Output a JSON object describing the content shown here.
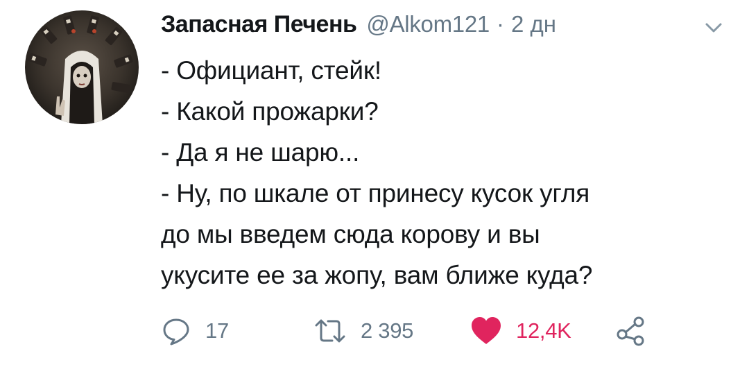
{
  "tweet": {
    "author": {
      "display_name": "Запасная Печень",
      "handle": "@Alkom121",
      "avatar_icon": "user-avatar"
    },
    "separator": "·",
    "timestamp": "2 дн",
    "menu_icon": "chevron-down-icon",
    "text_lines": [
      "- Официант, стейк!",
      "- Какой прожарки?",
      "- Да я не шарю...",
      "- Ну, по шкале от принесу кусок угля",
      "до мы введем сюда корову и вы",
      "укусите ее за жопу, вам ближе куда?"
    ],
    "actions": {
      "reply": {
        "icon": "reply-icon",
        "count": "17"
      },
      "retweet": {
        "icon": "retweet-icon",
        "count": "2 395"
      },
      "like": {
        "icon": "heart-icon",
        "count": "12,4K",
        "liked": true
      },
      "share": {
        "icon": "share-icon"
      }
    },
    "colors": {
      "text": "#14171a",
      "secondary": "#657786",
      "like": "#e0245e"
    }
  }
}
